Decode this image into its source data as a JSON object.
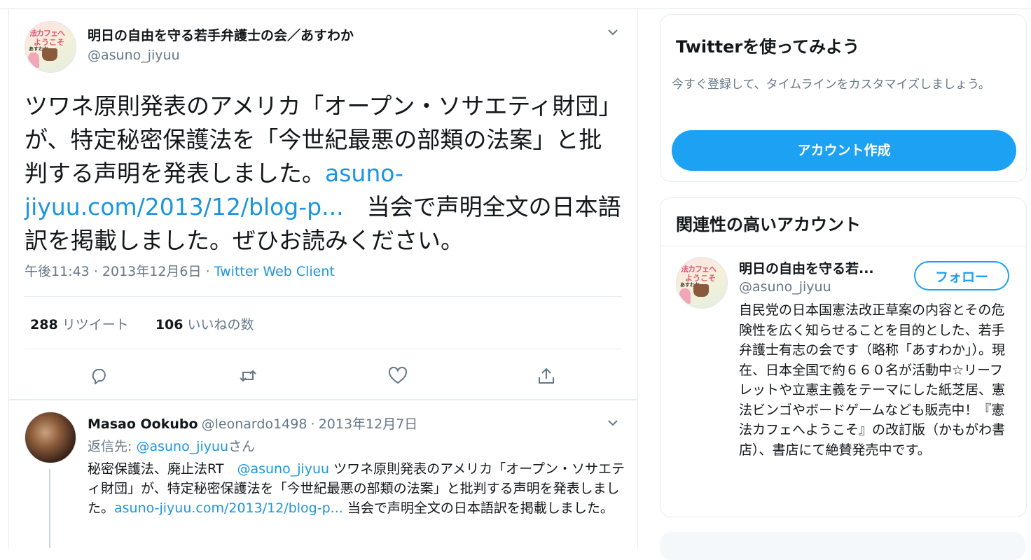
{
  "tweet": {
    "author_name": "明日の自由を守る若手弁護士の会／あすわか",
    "author_handle": "@asuno_jiyuu",
    "text_before": "ツワネ原則発表のアメリカ「オープン・ソサエティ財団」が、特定秘密保護法を「今世紀最悪の部類の法案」と批判する声明を発表しました。",
    "link": "asuno-jiyuu.com/2013/12/blog-p...",
    "text_after": "　当会で声明全文の日本語訳を掲載しました。ぜひお読みください。",
    "time": "午後11:43",
    "date": "2013年12月6日",
    "dot": "·",
    "client": "Twitter Web Client",
    "retweet_count": "288",
    "retweet_label": "リツイート",
    "like_count": "106",
    "like_label": "いいねの数",
    "icons": [
      "reply-icon",
      "retweet-icon",
      "like-icon",
      "share-icon"
    ]
  },
  "reply": {
    "name": "Masao Ookubo",
    "handle": "@leonardo1498",
    "dot": "·",
    "date": "2013年12月7日",
    "reply_to_prefix": "返信先:",
    "reply_to_handle": "@asuno_jiyuu",
    "reply_to_suffix": "さん",
    "text_1": "秘密保護法、廃止法RT　",
    "mention": "@asuno_jiyuu",
    "text_2": " ツワネ原則発表のアメリカ「オープン・ソサエティ財団」が、特定秘密保護法を「今世紀最悪の部類の法案」と批判する声明を発表しました。",
    "link": "asuno-jiyuu.com/2013/12/blog-p...",
    "text_3": " 当会で声明全文の日本語訳を掲載しました。"
  },
  "signup": {
    "title": "Twitterを使ってみよう",
    "description": "今すぐ登録して、タイムラインをカスタマイズしましょう。",
    "button": "アカウント作成"
  },
  "related": {
    "title": "関連性の高いアカウント",
    "name": "明日の自由を守る若...",
    "handle": "@asuno_jiyuu",
    "follow": "フォロー",
    "bio": "自民党の日本国憲法改正草案の内容とその危険性を広く知らせることを目的とした、若手弁護士有志の会です（略称「あすわか」）。現在、日本全国で約６６０名が活動中☆リーフレットや立憲主義をテーマにした紙芝居、憲法ビンゴやボードゲームなども販売中！『憲法カフェへようこそ』の改訂版（かもがわ書店）、書店にて絶賛発売中です。"
  },
  "avatar_book": {
    "line1": "法カフェへ",
    "line2": "ようこそ",
    "line3": "あすわか"
  },
  "colors": {
    "accent": "#1da1f2",
    "link": "#1b95e0",
    "secondary_text": "#657786",
    "border": "#e6ecf0"
  }
}
